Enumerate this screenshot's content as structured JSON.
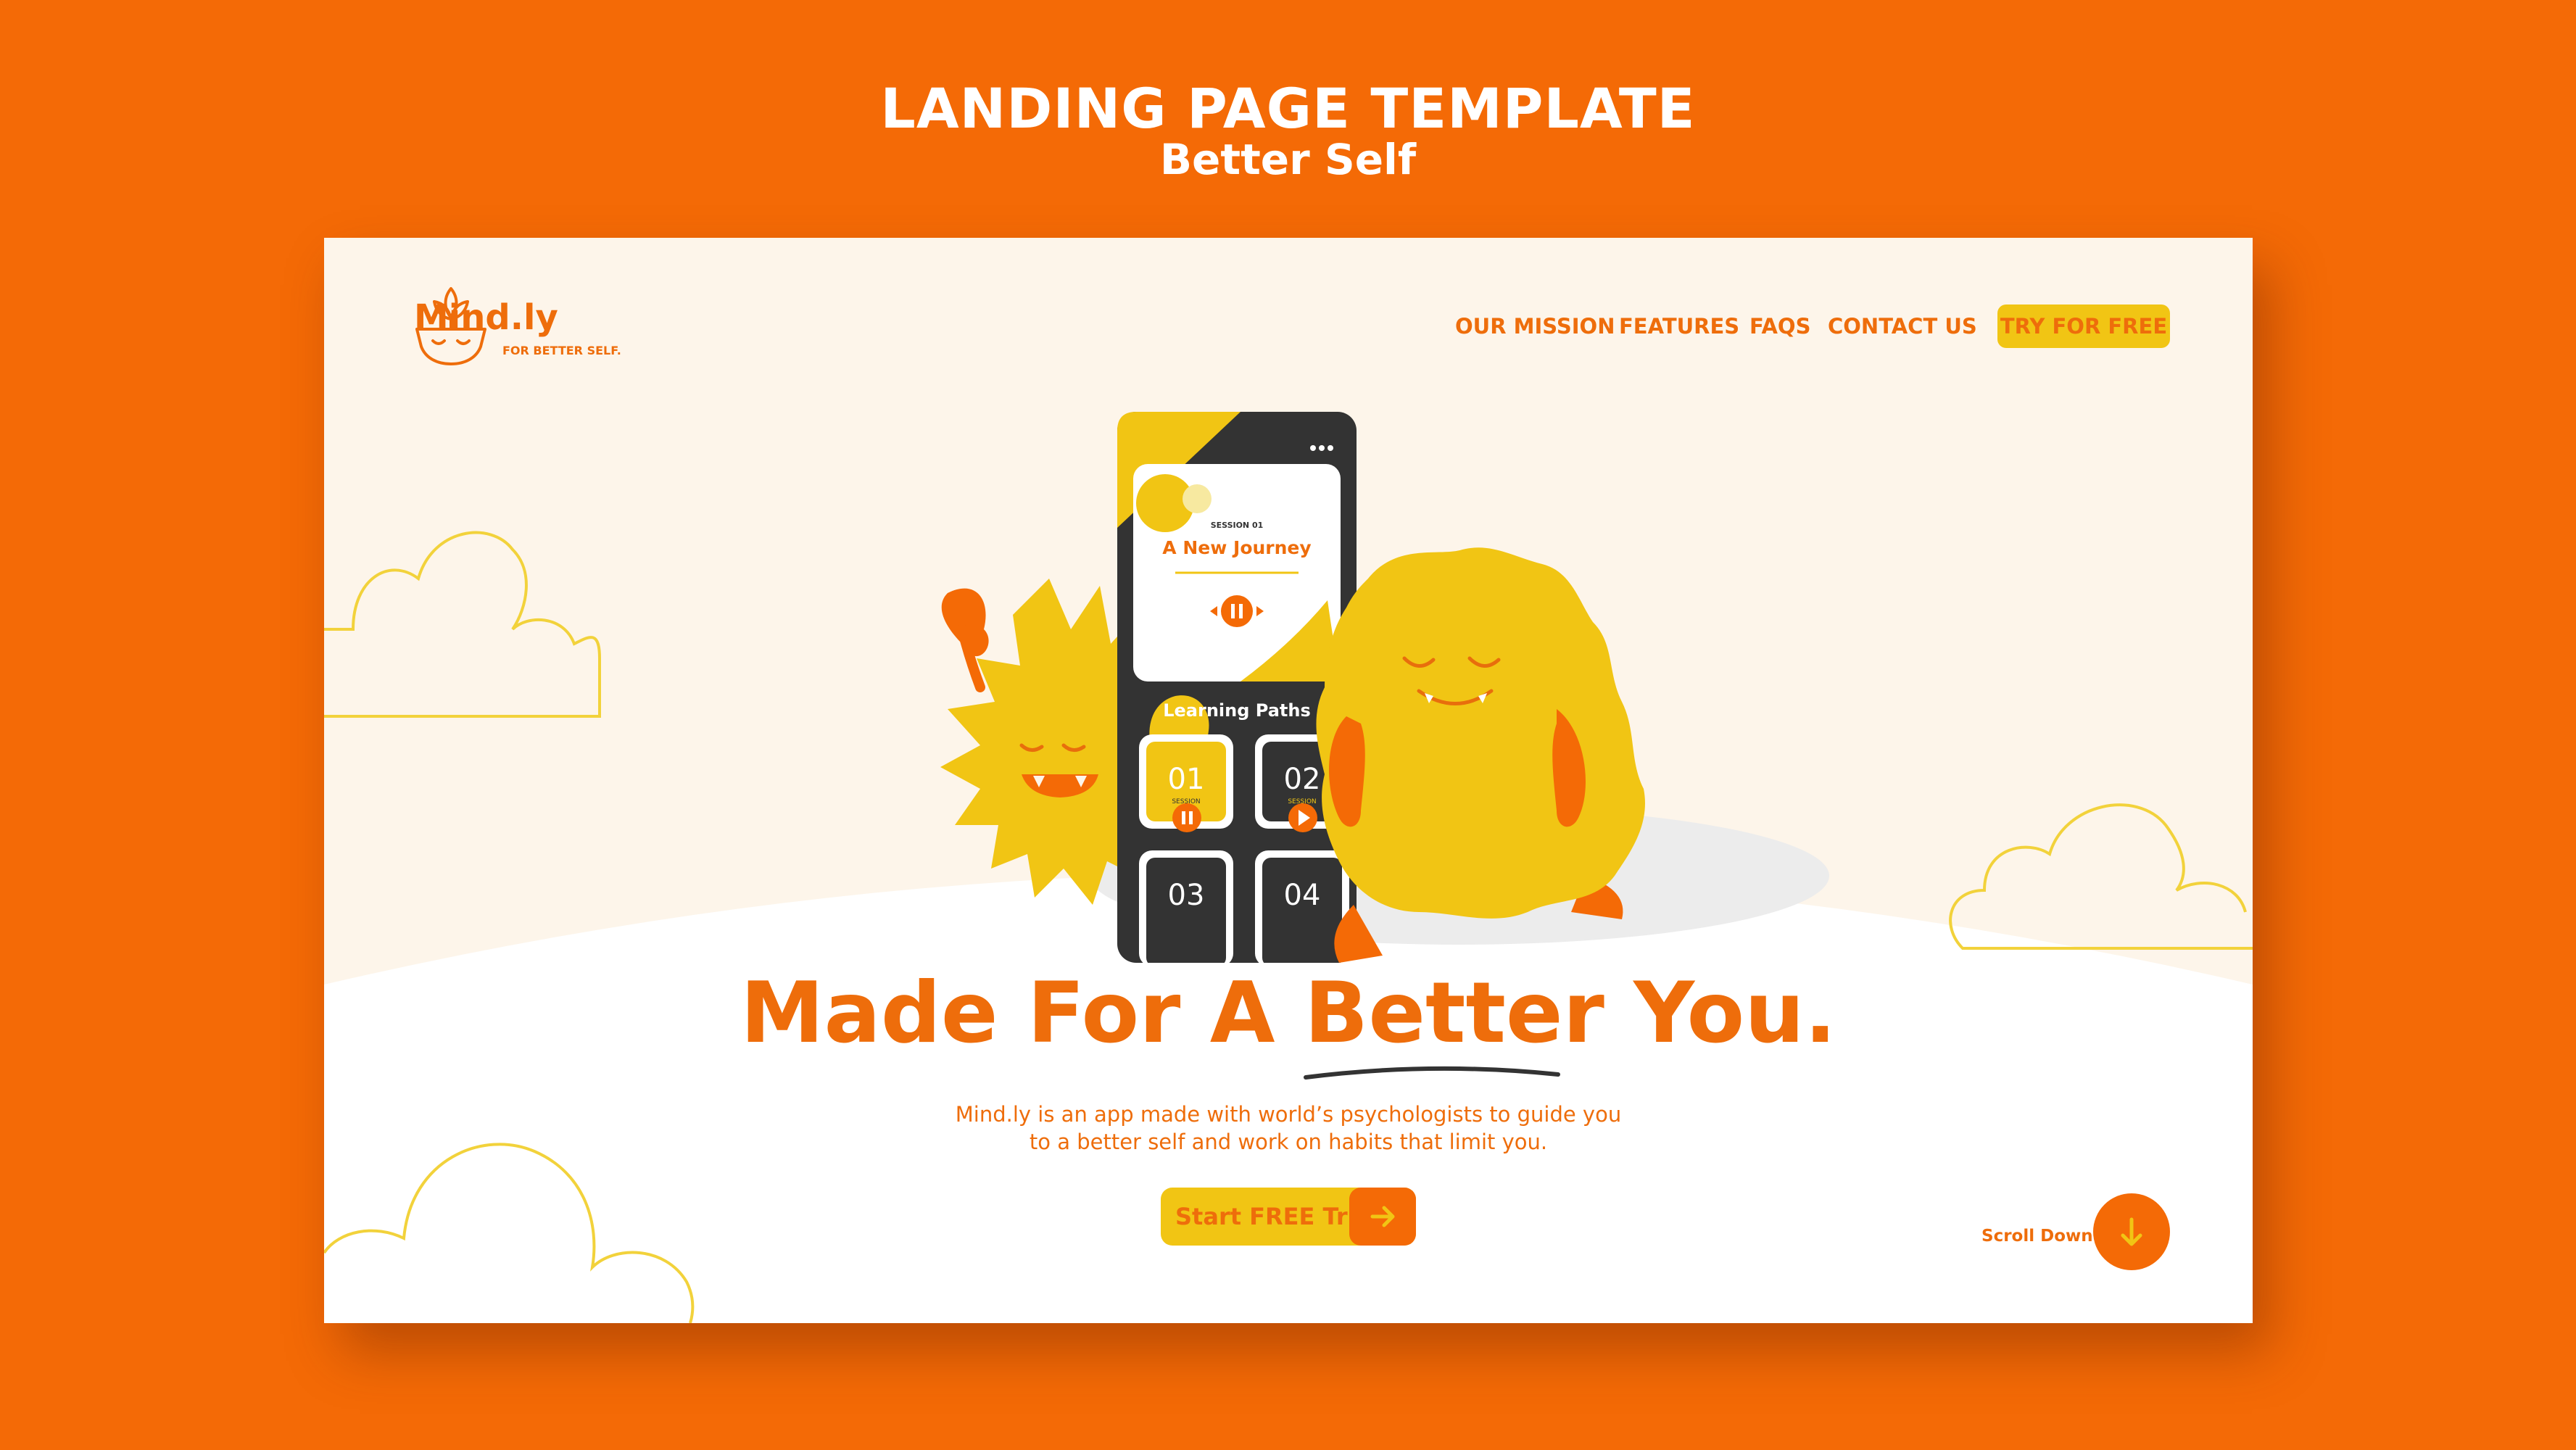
{
  "template": {
    "title": "LANDING PAGE TEMPLATE",
    "subtitle": "Better Self"
  },
  "header": {
    "brand": "Mind.ly",
    "tagline": "FOR BETTER SELF.",
    "nav": [
      "OUR MISSION",
      "FEATURES",
      "FAQS",
      "CONTACT US"
    ],
    "cta": "TRY FOR FREE"
  },
  "phone": {
    "session_label": "SESSION 01",
    "session_title": "A New Journey",
    "section_title": "Learning Paths",
    "tiles": [
      {
        "number": "01",
        "label": "SESSION"
      },
      {
        "number": "02",
        "label": "SESSION"
      },
      {
        "number": "03",
        "label": ""
      },
      {
        "number": "04",
        "label": ""
      }
    ]
  },
  "hero": {
    "headline": "Made For A Better You.",
    "description_line1": "Mind.ly is an app made with world’s psychologists to guide you",
    "description_line2": "to a better self and work on habits that limit you.",
    "button_label": "Start FREE Trial"
  },
  "scroll": {
    "label": "Scroll Down"
  },
  "icons": {
    "logo": "plant-pot-icon",
    "start_arrow": "arrow-right-icon",
    "scroll_arrow": "arrow-down-icon",
    "phone_back": "chevron-left-icon",
    "phone_menu": "more-horizontal-icon"
  },
  "colors": {
    "background": "#f46a06",
    "page": "#fdf5ea",
    "accent_orange": "#ee6d0b",
    "accent_yellow": "#f1c514",
    "phone_dark": "#333333"
  }
}
